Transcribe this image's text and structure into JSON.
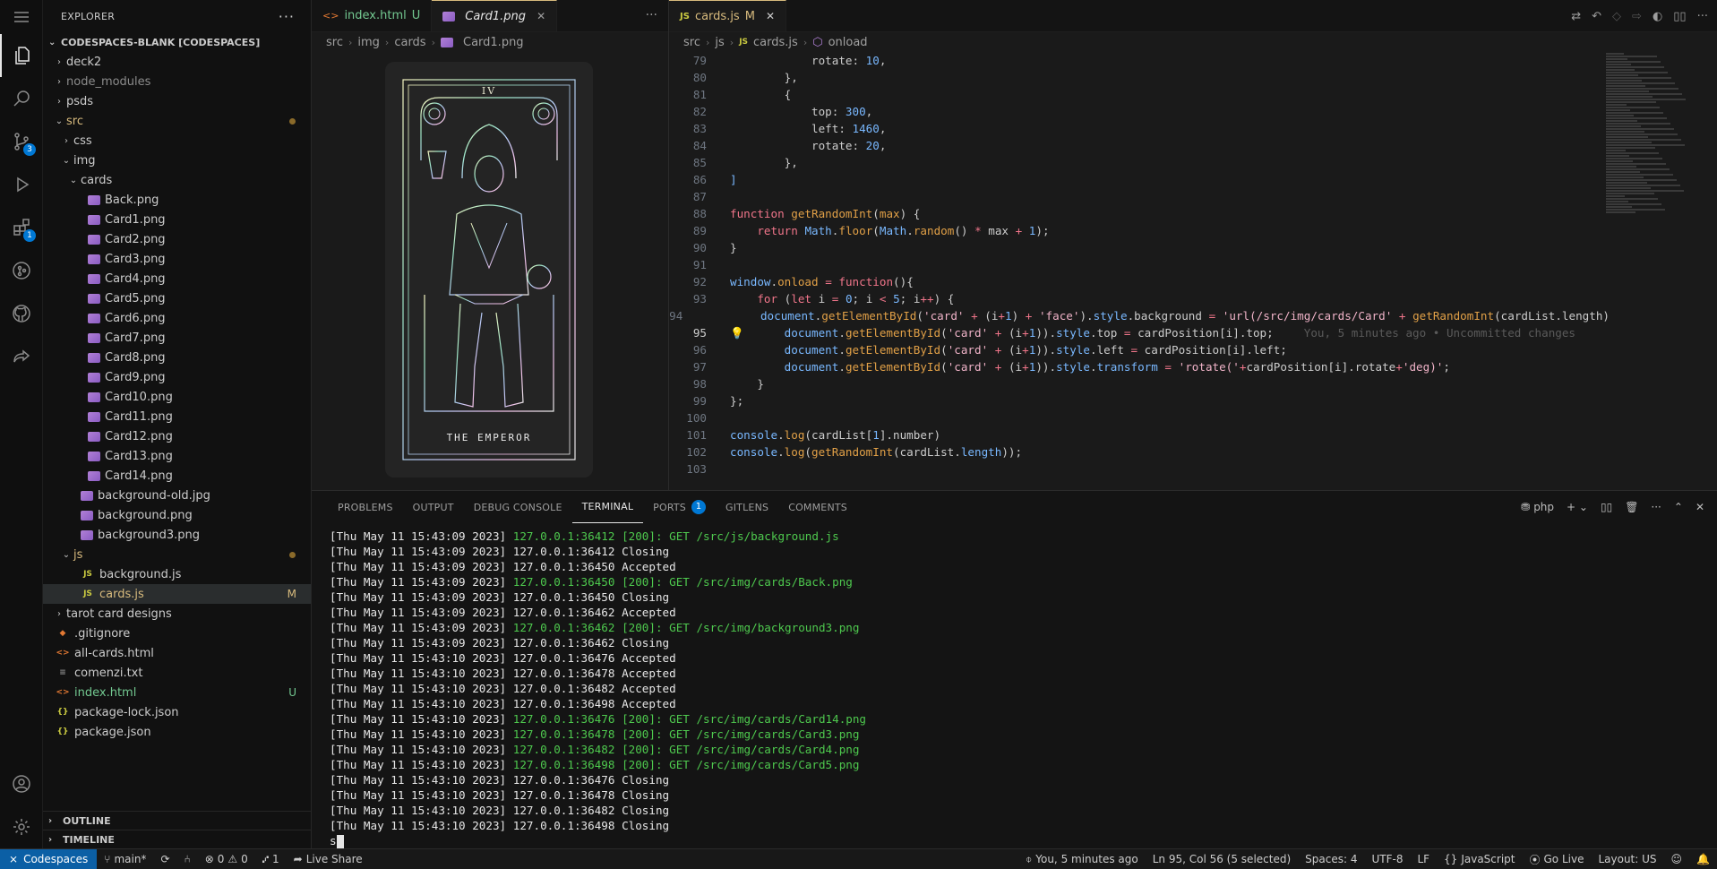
{
  "explorer": {
    "title": "EXPLORER",
    "root": "CODESPACES-BLANK [CODESPACES]",
    "items": [
      {
        "label": "deck2",
        "type": "folder",
        "depth": 0,
        "open": false
      },
      {
        "label": "node_modules",
        "type": "folder",
        "depth": 0,
        "open": false,
        "dim": true
      },
      {
        "label": "psds",
        "type": "folder",
        "depth": 0,
        "open": false
      },
      {
        "label": "src",
        "type": "folder",
        "depth": 0,
        "open": true,
        "status": "modified-dot"
      },
      {
        "label": "css",
        "type": "folder",
        "depth": 1,
        "open": false
      },
      {
        "label": "img",
        "type": "folder",
        "depth": 1,
        "open": true
      },
      {
        "label": "cards",
        "type": "folder",
        "depth": 2,
        "open": true
      },
      {
        "label": "Back.png",
        "type": "png",
        "depth": 3
      },
      {
        "label": "Card1.png",
        "type": "png",
        "depth": 3
      },
      {
        "label": "Card2.png",
        "type": "png",
        "depth": 3
      },
      {
        "label": "Card3.png",
        "type": "png",
        "depth": 3
      },
      {
        "label": "Card4.png",
        "type": "png",
        "depth": 3
      },
      {
        "label": "Card5.png",
        "type": "png",
        "depth": 3
      },
      {
        "label": "Card6.png",
        "type": "png",
        "depth": 3
      },
      {
        "label": "Card7.png",
        "type": "png",
        "depth": 3
      },
      {
        "label": "Card8.png",
        "type": "png",
        "depth": 3
      },
      {
        "label": "Card9.png",
        "type": "png",
        "depth": 3
      },
      {
        "label": "Card10.png",
        "type": "png",
        "depth": 3
      },
      {
        "label": "Card11.png",
        "type": "png",
        "depth": 3
      },
      {
        "label": "Card12.png",
        "type": "png",
        "depth": 3
      },
      {
        "label": "Card13.png",
        "type": "png",
        "depth": 3
      },
      {
        "label": "Card14.png",
        "type": "png",
        "depth": 3
      },
      {
        "label": "background-old.jpg",
        "type": "png",
        "depth": 2
      },
      {
        "label": "background.png",
        "type": "png",
        "depth": 2
      },
      {
        "label": "background3.png",
        "type": "png",
        "depth": 2
      },
      {
        "label": "js",
        "type": "folder",
        "depth": 1,
        "open": true,
        "status": "modified-dot",
        "color": "src"
      },
      {
        "label": "background.js",
        "type": "js",
        "depth": 2
      },
      {
        "label": "cards.js",
        "type": "js",
        "depth": 2,
        "status": "M",
        "selected": true
      },
      {
        "label": "tarot card designs",
        "type": "folder",
        "depth": 0,
        "open": false
      },
      {
        "label": ".gitignore",
        "type": "git",
        "depth": 0
      },
      {
        "label": "all-cards.html",
        "type": "html",
        "depth": 0
      },
      {
        "label": "comenzi.txt",
        "type": "txt",
        "depth": 0
      },
      {
        "label": "index.html",
        "type": "html",
        "depth": 0,
        "status": "U"
      },
      {
        "label": "package-lock.json",
        "type": "json",
        "depth": 0
      },
      {
        "label": "package.json",
        "type": "json",
        "depth": 0
      }
    ],
    "outline": "OUTLINE",
    "timeline": "TIMELINE"
  },
  "activity_badges": {
    "scm": "3",
    "extensions": "1"
  },
  "editor1": {
    "tabs": [
      {
        "label": "index.html",
        "status": "U",
        "icon": "html-icon"
      },
      {
        "label": "Card1.png",
        "icon": "image-icon",
        "active": true
      }
    ],
    "breadcrumb": [
      "src",
      "img",
      "cards",
      "Card1.png"
    ],
    "card": {
      "numeral": "IV",
      "name": "THE EMPEROR"
    }
  },
  "editor2": {
    "tab": {
      "label": "cards.js",
      "status": "M",
      "icon": "js-icon"
    },
    "breadcrumb": [
      "src",
      "js",
      "cards.js",
      "onload"
    ],
    "current_line": 95,
    "blame": "You, 5 minutes ago • Uncommitted changes"
  },
  "code_lines": [
    {
      "n": 79,
      "html": "            rotate: <span class=\"num\">10</span>,"
    },
    {
      "n": 80,
      "html": "        },"
    },
    {
      "n": 81,
      "html": "        {"
    },
    {
      "n": 82,
      "html": "            top: <span class=\"num\">300</span>,"
    },
    {
      "n": 83,
      "html": "            left: <span class=\"num\">1460</span>,"
    },
    {
      "n": 84,
      "html": "            rotate: <span class=\"num\">20</span>,"
    },
    {
      "n": 85,
      "html": "        },"
    },
    {
      "n": 86,
      "html": "<span class=\"obj\">]</span>"
    },
    {
      "n": 87,
      "html": ""
    },
    {
      "n": 88,
      "html": "<span class=\"kw\">function</span> <span class=\"fn\">getRandomInt</span>(<span class=\"fn\">max</span>) {"
    },
    {
      "n": 89,
      "html": "    <span class=\"kw\">return</span> <span class=\"obj\">Math</span>.<span class=\"fn\">floor</span>(<span class=\"obj\">Math</span>.<span class=\"fn\">random</span>() <span class=\"kw\">*</span> max <span class=\"kw\">+</span> <span class=\"num\">1</span>);"
    },
    {
      "n": 90,
      "html": "}"
    },
    {
      "n": 91,
      "html": ""
    },
    {
      "n": 92,
      "html": "<span class=\"obj\">window</span>.<span class=\"fn\">onload</span> <span class=\"kw\">=</span> <span class=\"kw\">function</span>(){"
    },
    {
      "n": 93,
      "html": "    <span class=\"kw\">for</span> (<span class=\"kw\">let</span> i <span class=\"kw\">=</span> <span class=\"num\">0</span>; i <span class=\"kw\">&lt;</span> <span class=\"num\">5</span>; i<span class=\"kw\">++</span>) {"
    },
    {
      "n": 94,
      "html": "        <span class=\"obj\">document</span>.<span class=\"fn\">getElementById</span>(<span class=\"str\">'card'</span> <span class=\"kw\">+</span> (i<span class=\"kw\">+</span><span class=\"num\">1</span>) <span class=\"kw\">+</span> <span class=\"str\">'face'</span>).<span class=\"obj\">style</span>.background <span class=\"kw\">=</span> <span class=\"str\">'url(/src/img/cards/Card'</span> <span class=\"kw\">+</span> <span class=\"fn\">getRandomInt</span>(cardList.length)"
    },
    {
      "n": 95,
      "html": "        <span class=\"obj\">document</span>.<span class=\"fn\">getElementById</span>(<span class=\"str\">'card'</span> <span class=\"kw\">+</span> (i<span class=\"kw\">+</span><span class=\"num\">1</span>)).<span class=\"obj\">style</span>.top <span class=\"kw\">=</span> cardPosition[i].top;",
      "blame": true
    },
    {
      "n": 96,
      "html": "        <span class=\"obj\">document</span>.<span class=\"fn\">getElementById</span>(<span class=\"str\">'card'</span> <span class=\"kw\">+</span> (i<span class=\"kw\">+</span><span class=\"num\">1</span>)).<span class=\"obj\">style</span>.left <span class=\"kw\">=</span> cardPosition[i].left;"
    },
    {
      "n": 97,
      "html": "        <span class=\"obj\">document</span>.<span class=\"fn\">getElementById</span>(<span class=\"str\">'card'</span> <span class=\"kw\">+</span> (i<span class=\"kw\">+</span><span class=\"num\">1</span>)).<span class=\"obj\">style</span>.<span class=\"obj\">transform</span> <span class=\"kw\">=</span> <span class=\"str\">'rotate('</span><span class=\"kw\">+</span>cardPosition[i].rotate<span class=\"kw\">+</span><span class=\"str\">'deg)'</span>;"
    },
    {
      "n": 98,
      "html": "    }"
    },
    {
      "n": 99,
      "html": "};"
    },
    {
      "n": 100,
      "html": ""
    },
    {
      "n": 101,
      "html": "<span class=\"obj\">console</span>.<span class=\"fn\">log</span>(cardList[<span class=\"num\">1</span>].number)"
    },
    {
      "n": 102,
      "html": "<span class=\"obj\">console</span>.<span class=\"fn\">log</span>(<span class=\"fn\">getRandomInt</span>(cardList.<span class=\"obj\">length</span>));"
    },
    {
      "n": 103,
      "html": ""
    }
  ],
  "panel": {
    "tabs": [
      "PROBLEMS",
      "OUTPUT",
      "DEBUG CONSOLE",
      "TERMINAL",
      "PORTS",
      "GITLENS",
      "COMMENTS"
    ],
    "active_tab": "TERMINAL",
    "ports_badge": "1",
    "shell": "php"
  },
  "terminal_lines": [
    {
      "ts": "[Thu May 11 15:43:09 2023]",
      "addr": "127.0.0.1:36412",
      "msg": "[200]: GET /src/js/background.js",
      "ok": true
    },
    {
      "ts": "[Thu May 11 15:43:09 2023]",
      "addr": "127.0.0.1:36412",
      "msg": "Closing"
    },
    {
      "ts": "[Thu May 11 15:43:09 2023]",
      "addr": "127.0.0.1:36450",
      "msg": "Accepted"
    },
    {
      "ts": "[Thu May 11 15:43:09 2023]",
      "addr": "127.0.0.1:36450",
      "msg": "[200]: GET /src/img/cards/Back.png",
      "ok": true
    },
    {
      "ts": "[Thu May 11 15:43:09 2023]",
      "addr": "127.0.0.1:36450",
      "msg": "Closing"
    },
    {
      "ts": "[Thu May 11 15:43:09 2023]",
      "addr": "127.0.0.1:36462",
      "msg": "Accepted"
    },
    {
      "ts": "[Thu May 11 15:43:09 2023]",
      "addr": "127.0.0.1:36462",
      "msg": "[200]: GET /src/img/background3.png",
      "ok": true
    },
    {
      "ts": "[Thu May 11 15:43:09 2023]",
      "addr": "127.0.0.1:36462",
      "msg": "Closing"
    },
    {
      "ts": "[Thu May 11 15:43:10 2023]",
      "addr": "127.0.0.1:36476",
      "msg": "Accepted"
    },
    {
      "ts": "[Thu May 11 15:43:10 2023]",
      "addr": "127.0.0.1:36478",
      "msg": "Accepted"
    },
    {
      "ts": "[Thu May 11 15:43:10 2023]",
      "addr": "127.0.0.1:36482",
      "msg": "Accepted"
    },
    {
      "ts": "[Thu May 11 15:43:10 2023]",
      "addr": "127.0.0.1:36498",
      "msg": "Accepted"
    },
    {
      "ts": "[Thu May 11 15:43:10 2023]",
      "addr": "127.0.0.1:36476",
      "msg": "[200]: GET /src/img/cards/Card14.png",
      "ok": true
    },
    {
      "ts": "[Thu May 11 15:43:10 2023]",
      "addr": "127.0.0.1:36478",
      "msg": "[200]: GET /src/img/cards/Card3.png",
      "ok": true
    },
    {
      "ts": "[Thu May 11 15:43:10 2023]",
      "addr": "127.0.0.1:36482",
      "msg": "[200]: GET /src/img/cards/Card4.png",
      "ok": true
    },
    {
      "ts": "[Thu May 11 15:43:10 2023]",
      "addr": "127.0.0.1:36498",
      "msg": "[200]: GET /src/img/cards/Card5.png",
      "ok": true
    },
    {
      "ts": "[Thu May 11 15:43:10 2023]",
      "addr": "127.0.0.1:36476",
      "msg": "Closing"
    },
    {
      "ts": "[Thu May 11 15:43:10 2023]",
      "addr": "127.0.0.1:36478",
      "msg": "Closing"
    },
    {
      "ts": "[Thu May 11 15:43:10 2023]",
      "addr": "127.0.0.1:36482",
      "msg": "Closing"
    },
    {
      "ts": "[Thu May 11 15:43:10 2023]",
      "addr": "127.0.0.1:36498",
      "msg": "Closing"
    }
  ],
  "terminal_prompt": "s",
  "status": {
    "remote": "Codespaces",
    "branch": "main*",
    "errors": "0",
    "warnings": "0",
    "ports": "1",
    "live_share": "Live Share",
    "blame": "You, 5 minutes ago",
    "position": "Ln 95, Col 56 (5 selected)",
    "spaces": "Spaces: 4",
    "encoding": "UTF-8",
    "eol": "LF",
    "language": "JavaScript",
    "go_live": "Go Live",
    "layout": "Layout: US"
  },
  "colors": {
    "accent": "#0078d4",
    "modified": "#d7ba7d",
    "untracked": "#73c991",
    "terminal_ok": "#4ec94e"
  }
}
